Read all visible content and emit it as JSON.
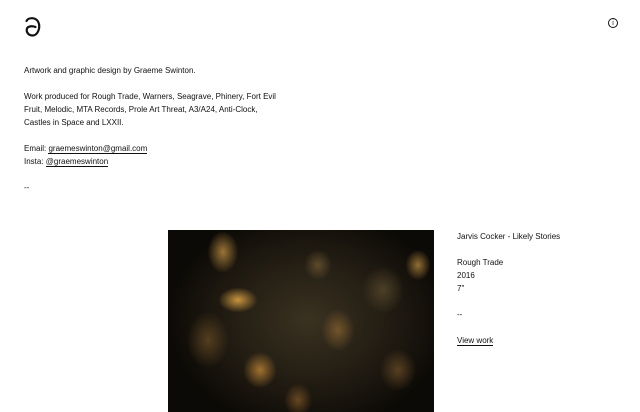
{
  "intro": {
    "bio": "Artwork and graphic design by Graeme Swinton.",
    "work_line_1": "Work produced for Rough Trade, Warners, Seagrave, Phinery, Fort Evil",
    "work_line_2": "Fruit, Melodic, MTA Records, Prole Art Threat, A3/A24, Anti-Clock,",
    "work_line_3": "Castles in Space and LXXII.",
    "email_label": "Email: ",
    "email": "graemeswinton@gmail.com",
    "insta_label": "Insta: ",
    "insta": "@graemeswinton",
    "separator": "--"
  },
  "header": {
    "info_icon_glyph": "i"
  },
  "work": {
    "title": "Jarvis Cocker - Likely Stories",
    "label": "Rough Trade",
    "year": "2016",
    "format": "7\"",
    "separator": "--",
    "view_link": "View work"
  },
  "icons": {
    "logo": "graeme-swinton-logo",
    "info": "info-icon"
  }
}
